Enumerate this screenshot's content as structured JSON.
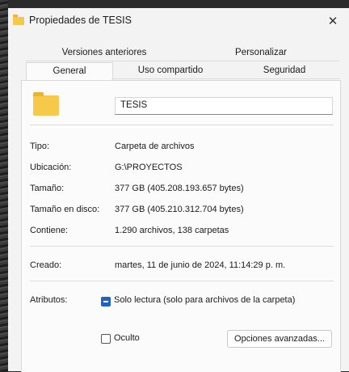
{
  "window": {
    "title": "Propiedades de TESIS",
    "close_glyph": "✕"
  },
  "tabs": {
    "row1": [
      {
        "label": "Versiones anteriores"
      },
      {
        "label": "Personalizar"
      }
    ],
    "row2": [
      {
        "label": "General",
        "active": true
      },
      {
        "label": "Uso compartido"
      },
      {
        "label": "Seguridad"
      }
    ]
  },
  "general": {
    "name": "TESIS",
    "icon": "folder-icon",
    "type": {
      "label": "Tipo:",
      "value": "Carpeta de archivos"
    },
    "location": {
      "label": "Ubicación:",
      "value": "G:\\PROYECTOS"
    },
    "size": {
      "label": "Tamaño:",
      "value": "377 GB (405.208.193.657 bytes)"
    },
    "size_on_disk": {
      "label": "Tamaño en disco:",
      "value": "377 GB (405.210.312.704 bytes)"
    },
    "contains": {
      "label": "Contiene:",
      "value": "1.290 archivos, 138 carpetas"
    },
    "created": {
      "label": "Creado:",
      "value": "martes, 11 de junio de 2024, 11:14:29 p. m."
    },
    "attributes": {
      "label": "Atributos:",
      "readonly": {
        "label": "Solo lectura (solo para archivos de la carpeta)",
        "checked": true
      },
      "hidden": {
        "label": "Oculto",
        "checked": false
      },
      "advanced_button": "Opciones avanzadas..."
    }
  },
  "colors": {
    "accent": "#1f63c4",
    "folder": "#f6c94a"
  }
}
